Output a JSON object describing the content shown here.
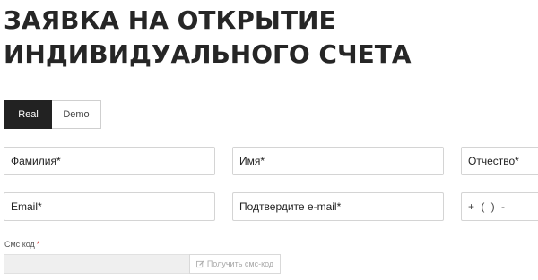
{
  "page": {
    "title_line1": "ЗАЯВКА НА ОТКРЫТИЕ",
    "title_line2": "ИНДИВИДУАЛЬНОГО СЧЕТА"
  },
  "tabs": [
    {
      "label": "Real",
      "active": true
    },
    {
      "label": "Demo",
      "active": false
    }
  ],
  "form": {
    "lastname_placeholder": "Фамилия*",
    "firstname_placeholder": "Имя*",
    "middlename_placeholder": "Отчество*",
    "email_placeholder": "Email*",
    "email_confirm_placeholder": "Подтвердите e-mail*",
    "phone_mask": "+ (   )   -",
    "sms_label": "Смс код",
    "sms_required_mark": "*",
    "sms_button_label": "Получить смс-код",
    "sms_button_icon": "edit-icon"
  },
  "colors": {
    "active_tab_bg": "#222222",
    "required_mark": "#d9534f",
    "disabled_input_bg": "#efefef"
  }
}
